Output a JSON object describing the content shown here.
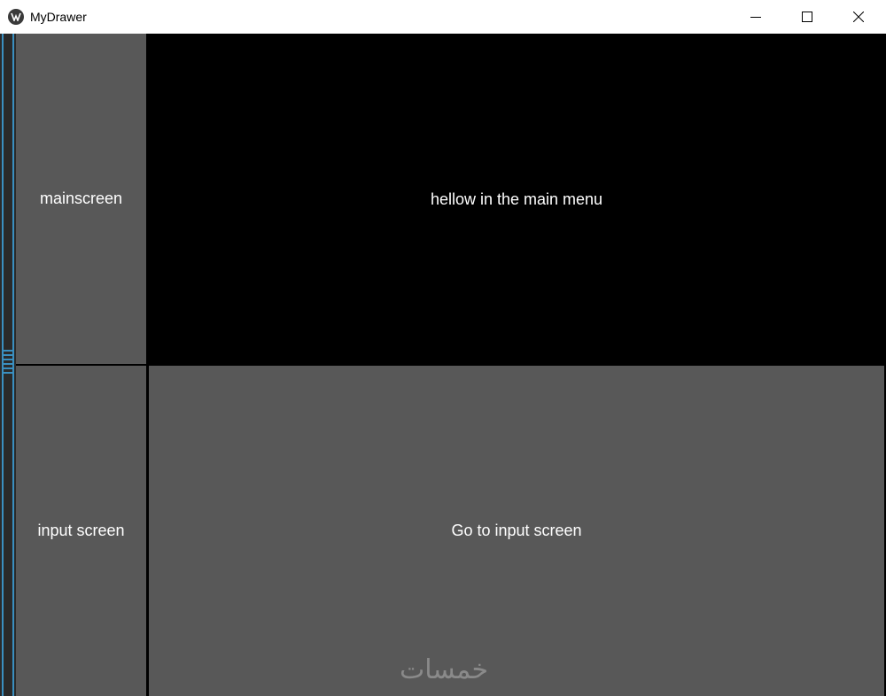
{
  "window": {
    "title": "MyDrawer"
  },
  "sidebar": {
    "items": [
      {
        "label": "mainscreen"
      },
      {
        "label": "input screen"
      }
    ]
  },
  "main": {
    "label": "hellow in the main menu",
    "button_label": "Go to input screen"
  },
  "watermark": {
    "text": "خمسات"
  },
  "colors": {
    "titlebar": "#ffffff",
    "background": "#000000",
    "button": "#585858",
    "drawer_accent": "#3a8fc0",
    "text": "#ffffff"
  },
  "icons": {
    "app": "kivy-app-icon",
    "minimize": "minimize-icon",
    "maximize": "maximize-icon",
    "close": "close-icon"
  }
}
